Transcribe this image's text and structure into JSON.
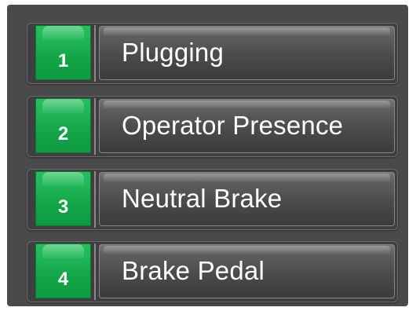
{
  "menu": {
    "items": [
      {
        "number": "1",
        "label": "Plugging"
      },
      {
        "number": "2",
        "label": "Operator Presence"
      },
      {
        "number": "3",
        "label": "Neutral Brake"
      },
      {
        "number": "4",
        "label": "Brake Pedal"
      }
    ]
  },
  "colors": {
    "panel": "#4a4a4a",
    "number_badge": "#1fb556",
    "label_text": "#ffffff"
  }
}
